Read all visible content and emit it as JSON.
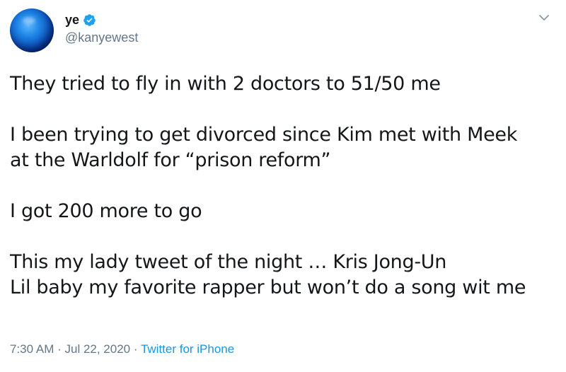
{
  "user": {
    "display_name": "ye",
    "handle": "@kanyewest",
    "verified": true
  },
  "tweet": {
    "lines": [
      "They tried to fly in with 2 doctors to 51/50 me",
      "",
      "I been trying to get divorced since Kim met with Meek",
      "at the Warldolf for “prison reform”",
      "",
      "I got 200 more to go",
      "",
      "This my lady tweet of the night … Kris Jong-Un",
      "Lil baby my favorite rapper but won’t do a song wit me"
    ]
  },
  "meta": {
    "time": "7:30 AM",
    "separator1": " · ",
    "date": "Jul 22, 2020",
    "separator2": " · ",
    "source": "Twitter for iPhone"
  },
  "icons": {
    "verified": "verified-badge-icon",
    "menu": "chevron-down-icon",
    "avatar": "avatar-globe"
  },
  "colors": {
    "text": "#14171a",
    "secondary": "#657786",
    "link": "#1b95e0",
    "verified": "#1da1f2"
  }
}
